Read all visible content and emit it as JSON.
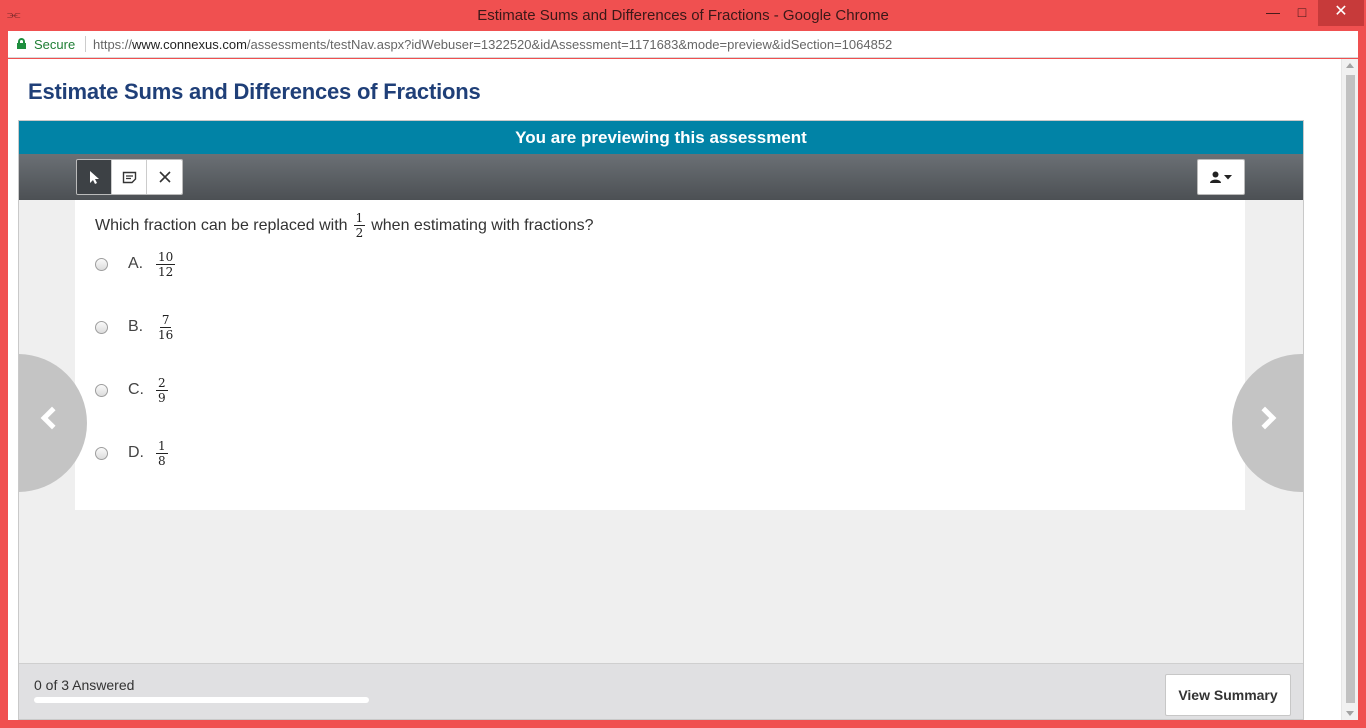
{
  "window": {
    "title": "Estimate Sums and Differences of Fractions - Google Chrome"
  },
  "address_bar": {
    "secure_label": "Secure",
    "url_scheme": "https://",
    "url_host": "www.connexus.com",
    "url_path": "/assessments/testNav.aspx?idWebuser=1322520&idAssessment=1171683&mode=preview&idSection=1064852"
  },
  "page": {
    "title": "Estimate Sums and Differences of Fractions"
  },
  "assessment": {
    "preview_banner": "You are previewing this assessment",
    "toolbar": {
      "tools": [
        {
          "name": "pointer-tool",
          "icon": "cursor-icon",
          "active": true
        },
        {
          "name": "note-tool",
          "icon": "note-icon",
          "active": false
        },
        {
          "name": "eliminate-tool",
          "icon": "cross-icon",
          "active": false
        }
      ],
      "user_menu_icon": "user-icon"
    },
    "question": {
      "text_before": "Which fraction can be replaced with",
      "fraction": {
        "numerator": "1",
        "denominator": "2"
      },
      "text_after": "when estimating with fractions?",
      "options": [
        {
          "letter": "A.",
          "numerator": "10",
          "denominator": "12"
        },
        {
          "letter": "B.",
          "numerator": "7",
          "denominator": "16"
        },
        {
          "letter": "C.",
          "numerator": "2",
          "denominator": "9"
        },
        {
          "letter": "D.",
          "numerator": "1",
          "denominator": "8"
        }
      ]
    },
    "footer": {
      "answered_text": "0 of 3 Answered",
      "answered_count": 0,
      "total_count": 3,
      "view_summary_label": "View Summary"
    }
  },
  "colors": {
    "window_frame": "#f05050",
    "banner": "#0183a6",
    "title_text": "#1f3f78"
  }
}
